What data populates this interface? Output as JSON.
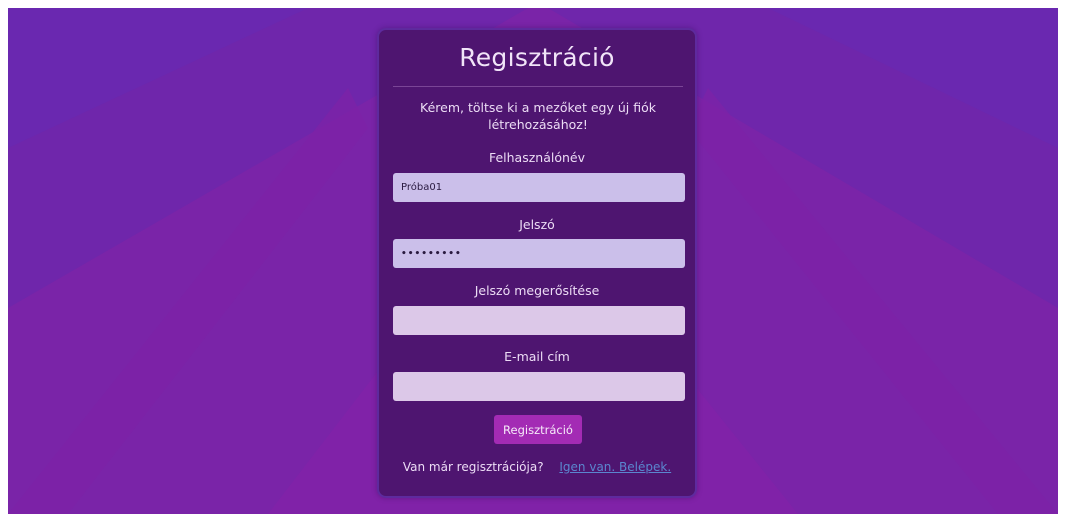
{
  "form": {
    "title": "Regisztráció",
    "intro": "Kérem, töltse ki a mezőket egy új fiók létrehozásához!",
    "username_label": "Felhasználónév",
    "username_value": "Próba01",
    "password_label": "Jelszó",
    "password_value": "•••••••••",
    "confirm_label": "Jelszó megerősítése",
    "confirm_value": "",
    "email_label": "E-mail cím",
    "email_value": "",
    "submit_label": "Regisztráció",
    "login_prompt": "Van már regisztrációja?",
    "login_link": "Igen van. Belépek."
  },
  "colors": {
    "background": "#7a24a8",
    "card": "#4e1570",
    "input": "#cbbfea",
    "button": "#a32bb4",
    "link": "#5b86cf"
  }
}
